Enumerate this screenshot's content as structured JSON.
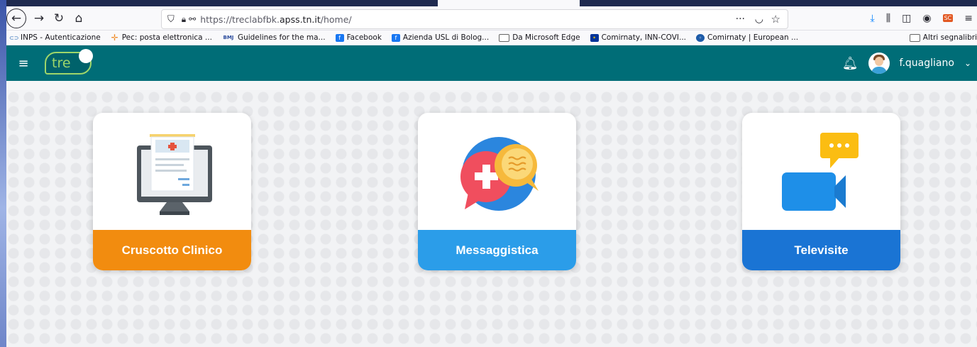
{
  "browser": {
    "url_prefix": "https://treclabfbk.",
    "url_domain": "apss.tn.it",
    "url_path": "/home/",
    "more_label": "···"
  },
  "bookmarks": [
    {
      "label": "INPS - Autenticazione",
      "icon": "inps-icon"
    },
    {
      "label": "Pec: posta elettronica ...",
      "icon": "pec-icon"
    },
    {
      "label": "Guidelines for the ma...",
      "icon": "bmj-icon"
    },
    {
      "label": "Facebook",
      "icon": "facebook-icon"
    },
    {
      "label": "Azienda USL di Bolog...",
      "icon": "facebook-icon"
    },
    {
      "label": "Da Microsoft Edge",
      "icon": "folder-icon"
    },
    {
      "label": "Comirnaty, INN-COVI...",
      "icon": "eu-flag-icon"
    },
    {
      "label": "Comirnaty | European ...",
      "icon": "ema-icon"
    }
  ],
  "bookmarks_other": "Altri segnalibri",
  "app": {
    "logo_text": "tre",
    "username": "f.quagliano",
    "teal": "#006d77"
  },
  "cards": [
    {
      "label": "Cruscotto Clinico",
      "color": "#f28c0f",
      "icon": "clinical-dashboard-monitor-icon"
    },
    {
      "label": "Messaggistica",
      "color": "#2b9de9",
      "icon": "chat-bubbles-icon"
    },
    {
      "label": "Televisite",
      "color": "#1a74d4",
      "icon": "video-camera-icon"
    }
  ]
}
